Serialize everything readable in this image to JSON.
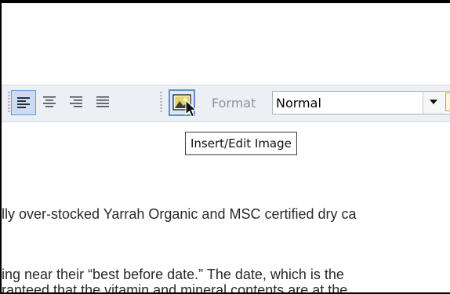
{
  "toolbar": {
    "buttons": [
      {
        "name": "align-left",
        "active": true
      },
      {
        "name": "align-center",
        "active": false
      },
      {
        "name": "align-right",
        "active": false
      },
      {
        "name": "align-justify",
        "active": false
      },
      {
        "name": "insert-edit-image",
        "active": false
      }
    ],
    "format_label": "Format",
    "format_value": "Normal",
    "help_icon_glyph": "?"
  },
  "tooltip": {
    "text": "Insert/Edit Image"
  },
  "editor": {
    "line1": "lly over-stocked Yarrah Organic and MSC certified dry ca",
    "line2": "ing near their “best before date.” The date, which is the",
    "line3": "ranteed that the vitamin and mineral contents are at the"
  },
  "colors": {
    "toolbar_bg": "#eceff3",
    "active_button_bg": "#c9dcf5",
    "active_button_border": "#6c9bd6",
    "text": "#262a2e"
  }
}
